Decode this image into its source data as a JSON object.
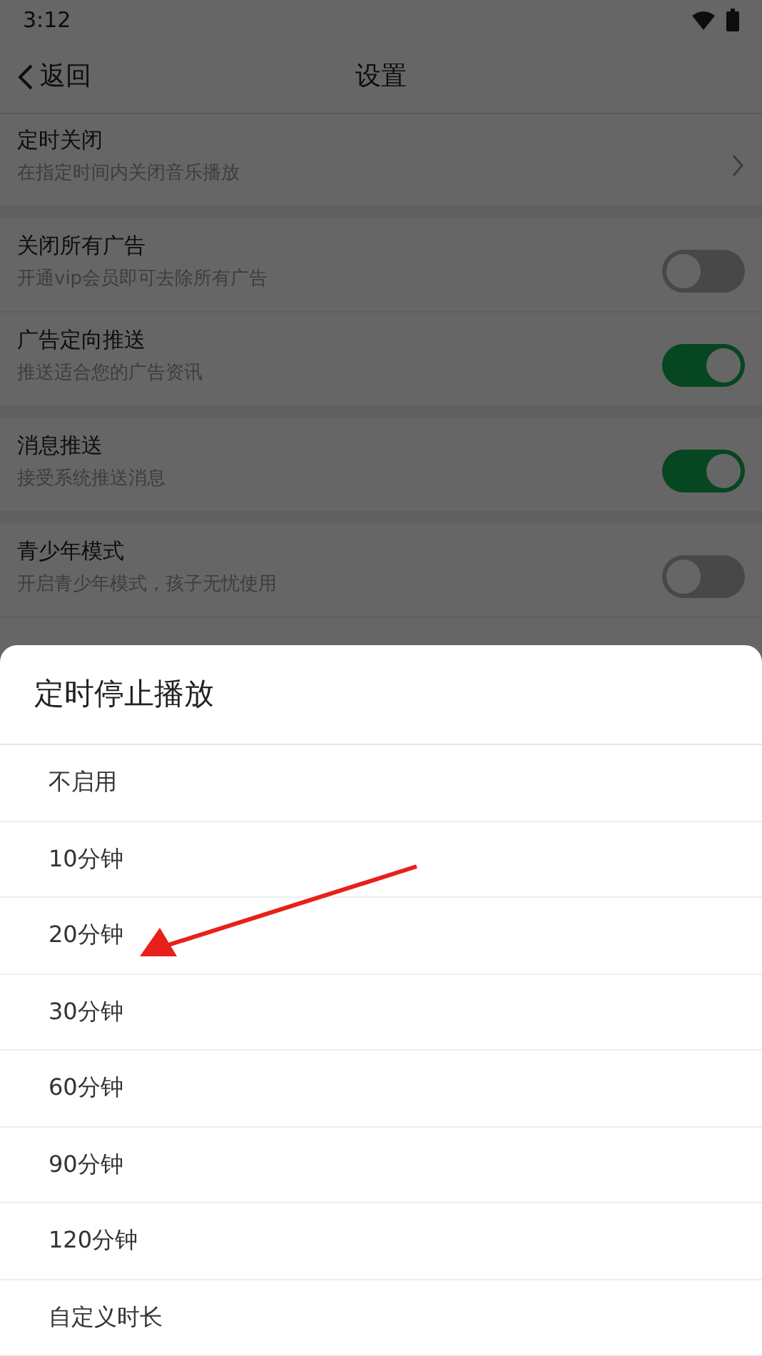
{
  "status_bar": {
    "time": "3:12"
  },
  "header": {
    "back": "返回",
    "title": "设置"
  },
  "sections": [
    {
      "rows": [
        {
          "kind": "link",
          "title": "定时关闭",
          "subtitle": "在指定时间内关闭音乐播放"
        }
      ]
    },
    {
      "rows": [
        {
          "kind": "toggle",
          "title": "关闭所有广告",
          "subtitle": "开通vip会员即可去除所有广告",
          "on": false
        },
        {
          "kind": "toggle",
          "title": "广告定向推送",
          "subtitle": "推送适合您的广告资讯",
          "on": true
        }
      ]
    },
    {
      "rows": [
        {
          "kind": "toggle",
          "title": "消息推送",
          "subtitle": "接受系统推送消息",
          "on": true
        }
      ]
    },
    {
      "rows": [
        {
          "kind": "toggle",
          "title": "青少年模式",
          "subtitle": "开启青少年模式，孩子无忧使用",
          "on": false
        }
      ]
    }
  ],
  "sheet": {
    "title": "定时停止播放",
    "options": [
      "不启用",
      "10分钟",
      "20分钟",
      "30分钟",
      "60分钟",
      "90分钟",
      "120分钟",
      "自定义时长"
    ]
  }
}
